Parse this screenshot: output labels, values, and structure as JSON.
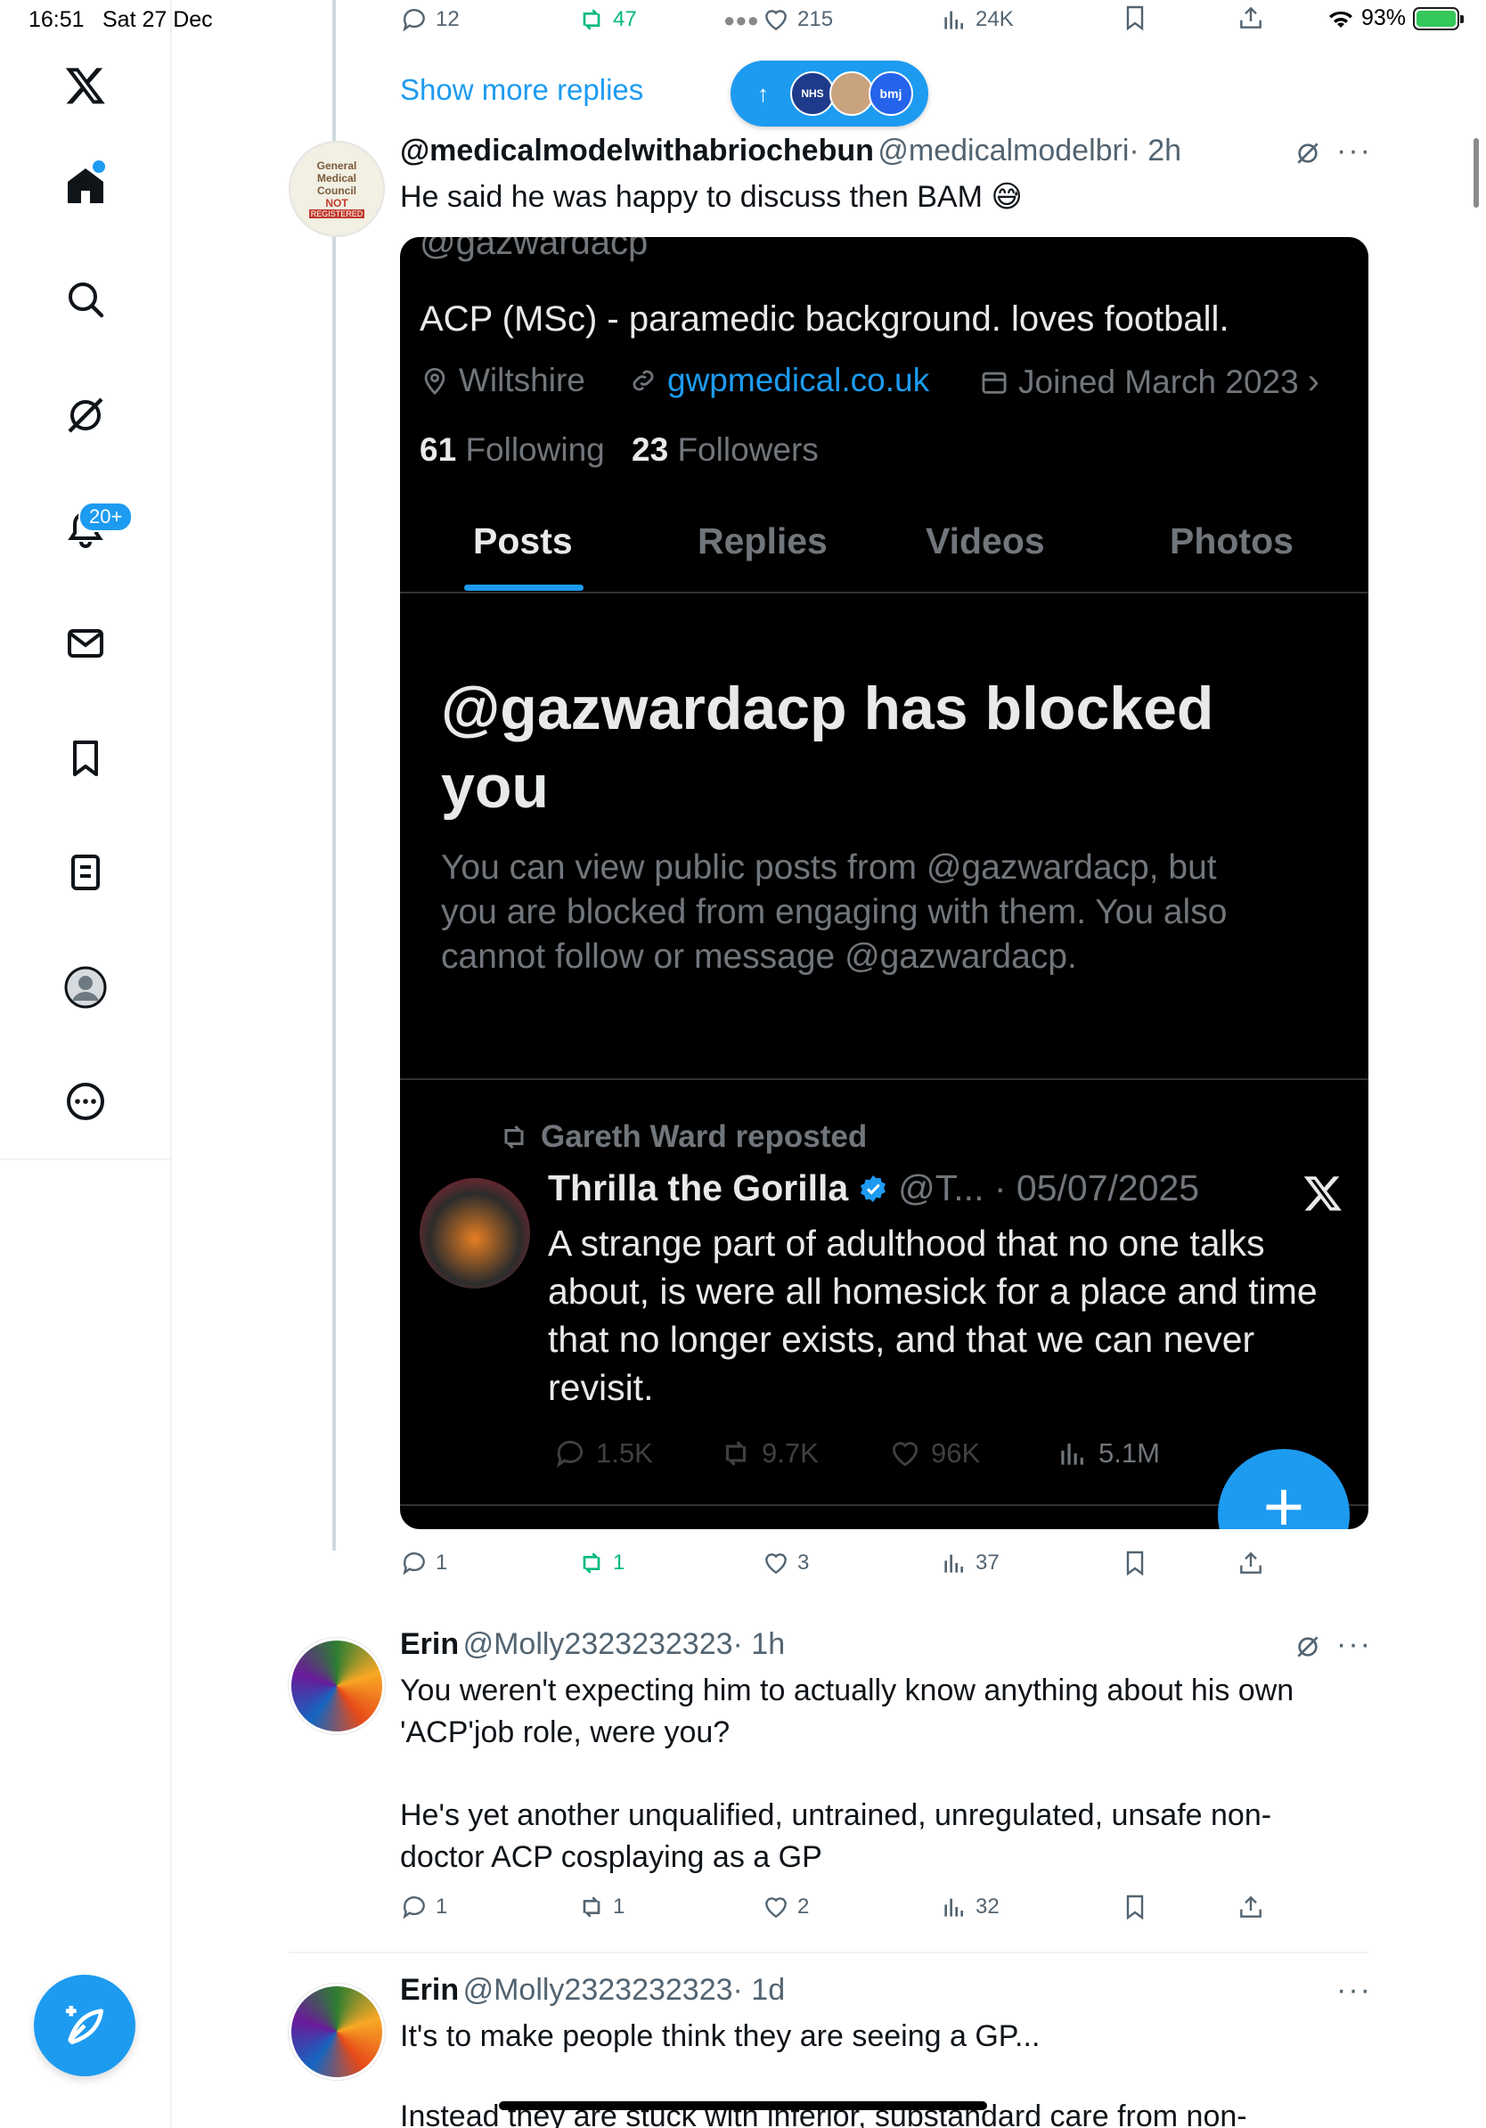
{
  "status_bar": {
    "time": "16:51",
    "date": "Sat 27 Dec",
    "battery": "93%",
    "battery_level": 0.93
  },
  "sidebar": {
    "items": [
      "home",
      "search",
      "grok",
      "notifications",
      "messages",
      "bookmarks",
      "lists",
      "profile",
      "more"
    ],
    "notifications_badge": "20+"
  },
  "top_actions": {
    "replies": "12",
    "reposts": "47",
    "likes": "215",
    "views": "24K"
  },
  "show_more_replies": "Show more replies",
  "new_posts_pill": {
    "avatar_labels": [
      "NHS",
      "",
      "bmj"
    ]
  },
  "post1": {
    "name": "@medicalmodelwithabriochebun",
    "handle": "@medicalmodelbri",
    "time": "· 2h",
    "text": "He said he was happy to discuss then BAM 😅",
    "avatar_text": [
      "General",
      "Medical",
      "Council",
      "NOT",
      "REGISTERED"
    ],
    "actions": {
      "replies": "1",
      "reposts": "1",
      "likes": "3",
      "views": "37"
    }
  },
  "screenshot": {
    "cut_handle": "@gazwardacp",
    "bio": "ACP (MSc) - paramedic background. loves football.",
    "location": "Wiltshire",
    "website": "gwpmedical.co.uk",
    "joined": "Joined March 2023",
    "following_count": "61",
    "following_label": "Following",
    "followers_count": "23",
    "followers_label": "Followers",
    "tabs": [
      "Posts",
      "Replies",
      "Videos",
      "Photos"
    ],
    "blocked_title_1": "@gazwardacp has blocked",
    "blocked_title_2": "you",
    "blocked_body_1": "You can view public posts from @gazwardacp, but",
    "blocked_body_2": "you are blocked from engaging with them. You also",
    "blocked_body_3": "cannot follow or message @gazwardacp.",
    "reposted_by": "Gareth Ward reposted",
    "inner_name": "Thrilla the Gorilla",
    "inner_meta": "@T... · 05/07/2025",
    "inner_text_1": "A strange part of adulthood that no one talks",
    "inner_text_2": "about, is were all homesick for a place and time",
    "inner_text_3": "that no longer exists, and that we can never",
    "inner_text_4": "revisit.",
    "inner_actions": {
      "replies": "1.5K",
      "reposts": "9.7K",
      "likes": "96K",
      "views": "5.1M"
    }
  },
  "post2": {
    "name": "Erin",
    "handle": "@Molly2323232323",
    "time": "· 1h",
    "text_1": "You weren't expecting him to actually know anything about his own",
    "text_2": "'ACP'job role, were you?",
    "text_3": "He's yet another unqualified, untrained, unregulated, unsafe non-",
    "text_4": "doctor ACP cosplaying as a GP",
    "actions": {
      "replies": "1",
      "reposts": "1",
      "likes": "2",
      "views": "32"
    }
  },
  "post3": {
    "name": "Erin",
    "handle": "@Molly2323232323",
    "time": "· 1d",
    "text_1": "It's to make people think they are seeing a GP...",
    "text_2": "Instead they are stuck with inferior, substandard care from non-"
  },
  "colors": {
    "accent": "#1d9bf0",
    "repost_green": "#00ba7c",
    "muted": "#536471"
  }
}
